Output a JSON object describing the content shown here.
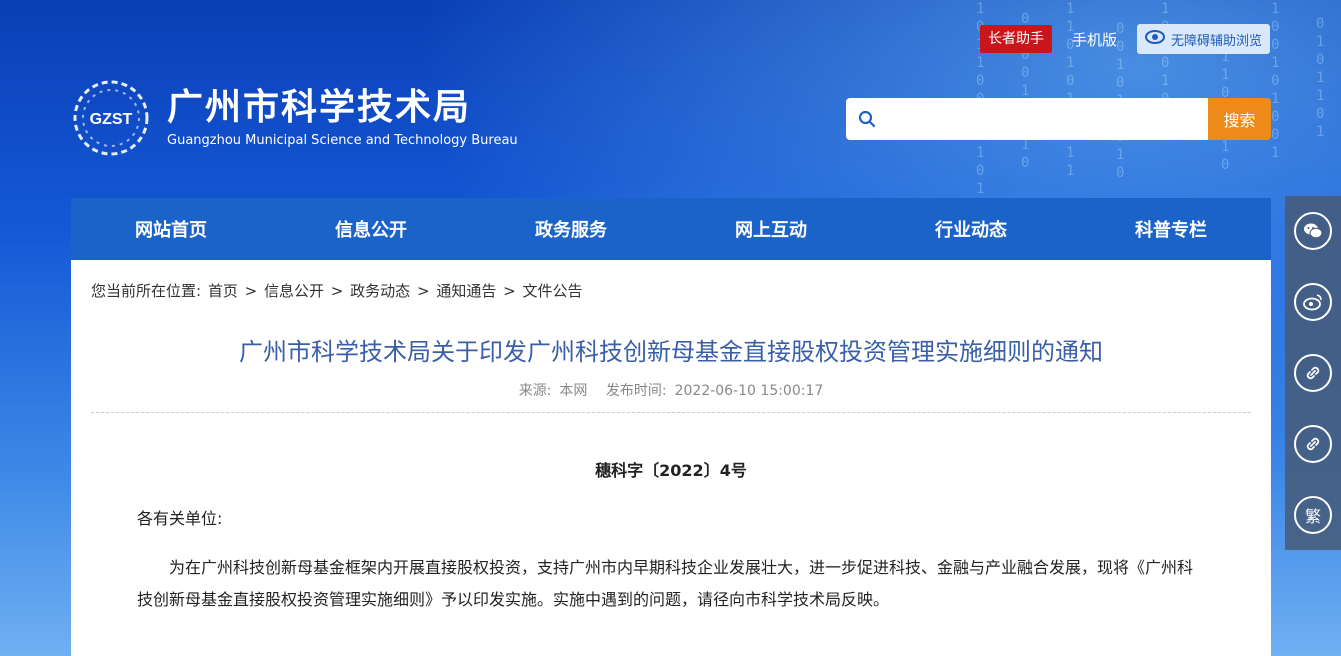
{
  "header": {
    "elder_assistant": "长者助手",
    "mobile": "手机版",
    "accessibility": "无障碍辅助浏览"
  },
  "logo": {
    "abbr": "GZST",
    "name_cn": "广州市科学技术局",
    "name_en": "Guangzhou Municipal Science and Technology Bureau"
  },
  "search": {
    "placeholder": "",
    "button": "搜索",
    "icon": "search-icon"
  },
  "nav": {
    "items": [
      "网站首页",
      "信息公开",
      "政务服务",
      "网上互动",
      "行业动态",
      "科普专栏"
    ]
  },
  "breadcrumb": {
    "prefix": "您当前所在位置:",
    "items": [
      "首页",
      "信息公开",
      "政务动态",
      "通知通告",
      "文件公告"
    ],
    "sep": ">"
  },
  "article": {
    "title": "广州市科学技术局关于印发广州科技创新母基金直接股权投资管理实施细则的通知",
    "source_label": "来源:",
    "source": "本网",
    "time_label": "发布时间:",
    "time": "2022-06-10 15:00:17",
    "doc_number": "穗科字〔2022〕4号",
    "salutation": "各有关单位:",
    "paragraph": "为在广州科技创新母基金框架内开展直接股权投资，支持广州市内早期科技企业发展壮大，进一步促进科技、金融与产业融合发展，现将《广州科技创新母基金直接股权投资管理实施细则》予以印发实施。实施中遇到的问题，请径向市科学技术局反映。"
  },
  "sidebar": {
    "items": [
      "wechat-icon",
      "weibo-icon",
      "link-icon",
      "link-icon",
      "繁"
    ],
    "traditional_label": "繁"
  },
  "colors": {
    "nav_bg": "#1b63c9",
    "search_btn": "#ee8a1a",
    "elder_btn": "#c8161d",
    "title_text": "#3a5fa8"
  }
}
